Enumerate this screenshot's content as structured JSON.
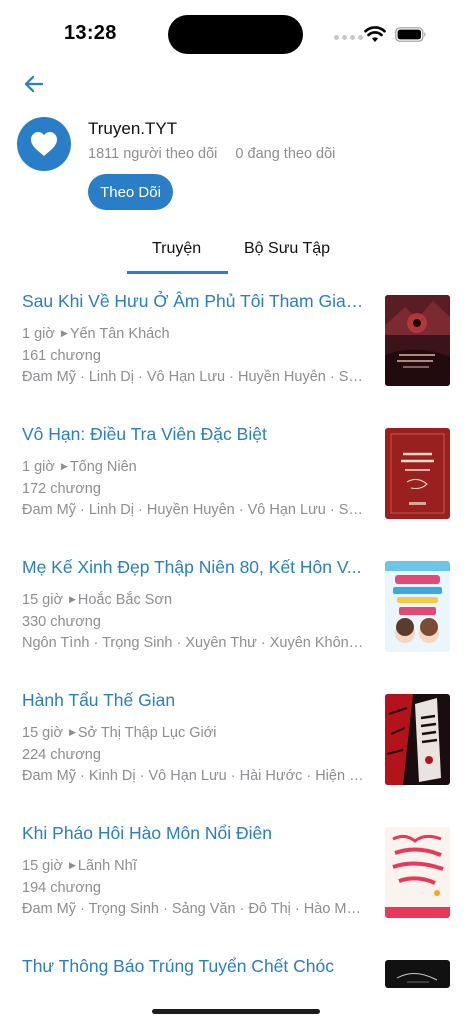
{
  "status": {
    "time": "13:28"
  },
  "profile": {
    "name": "Truyen.TYT",
    "followers": "1811 người theo dõi",
    "following": "0 đang theo dõi",
    "follow_label": "Theo Dõi"
  },
  "tabs": [
    {
      "label": "Truyện",
      "active": true
    },
    {
      "label": "Bộ Sưu Tập",
      "active": false
    }
  ],
  "accent_color": "#2a7ec8",
  "stories": [
    {
      "title": "Sau Khi Về Hưu Ở Âm Phủ Tôi Tham Gia T...",
      "time": "1 giờ",
      "author": "Yến Tân Khách",
      "chapters": "161 chương",
      "tags": "Đam Mỹ · Linh Dị · Vô Hạn Lưu · Huyền Huyễn · Sản..."
    },
    {
      "title": "Vô Hạn: Điều Tra Viên Đặc Biệt",
      "time": "1 giờ",
      "author": "Tống Niên",
      "chapters": "172 chương",
      "tags": "Đam Mỹ · Linh Dị · Huyền Huyễn · Vô Hạn Lưu · Sản..."
    },
    {
      "title": "Mẹ Kế Xinh Đẹp Thập Niên 80, Kết Hôn V...",
      "time": "15 giờ",
      "author": "Hoắc Bắc Sơn",
      "chapters": "330 chương",
      "tags": "Ngôn Tình · Trọng Sinh · Xuyên Thư · Xuyên Không ·..."
    },
    {
      "title": "Hành Tẩu Thế Gian",
      "time": "15 giờ",
      "author": "Sở Thị Thập Lục Giới",
      "chapters": "224 chương",
      "tags": "Đam Mỹ · Kinh Dị · Vô Hạn Lưu · Hài Hước · Hiện Đại..."
    },
    {
      "title": "Khi Pháo Hôi Hào Môn Nổi Điên",
      "time": "15 giờ",
      "author": "Lãnh Nhĩ",
      "chapters": "194 chương",
      "tags": "Đam Mỹ · Trọng Sinh · Sảng Văn · Đô Thị · Hào Môn..."
    },
    {
      "title": "Thư Thông Báo Trúng Tuyển Chết Chóc"
    }
  ]
}
